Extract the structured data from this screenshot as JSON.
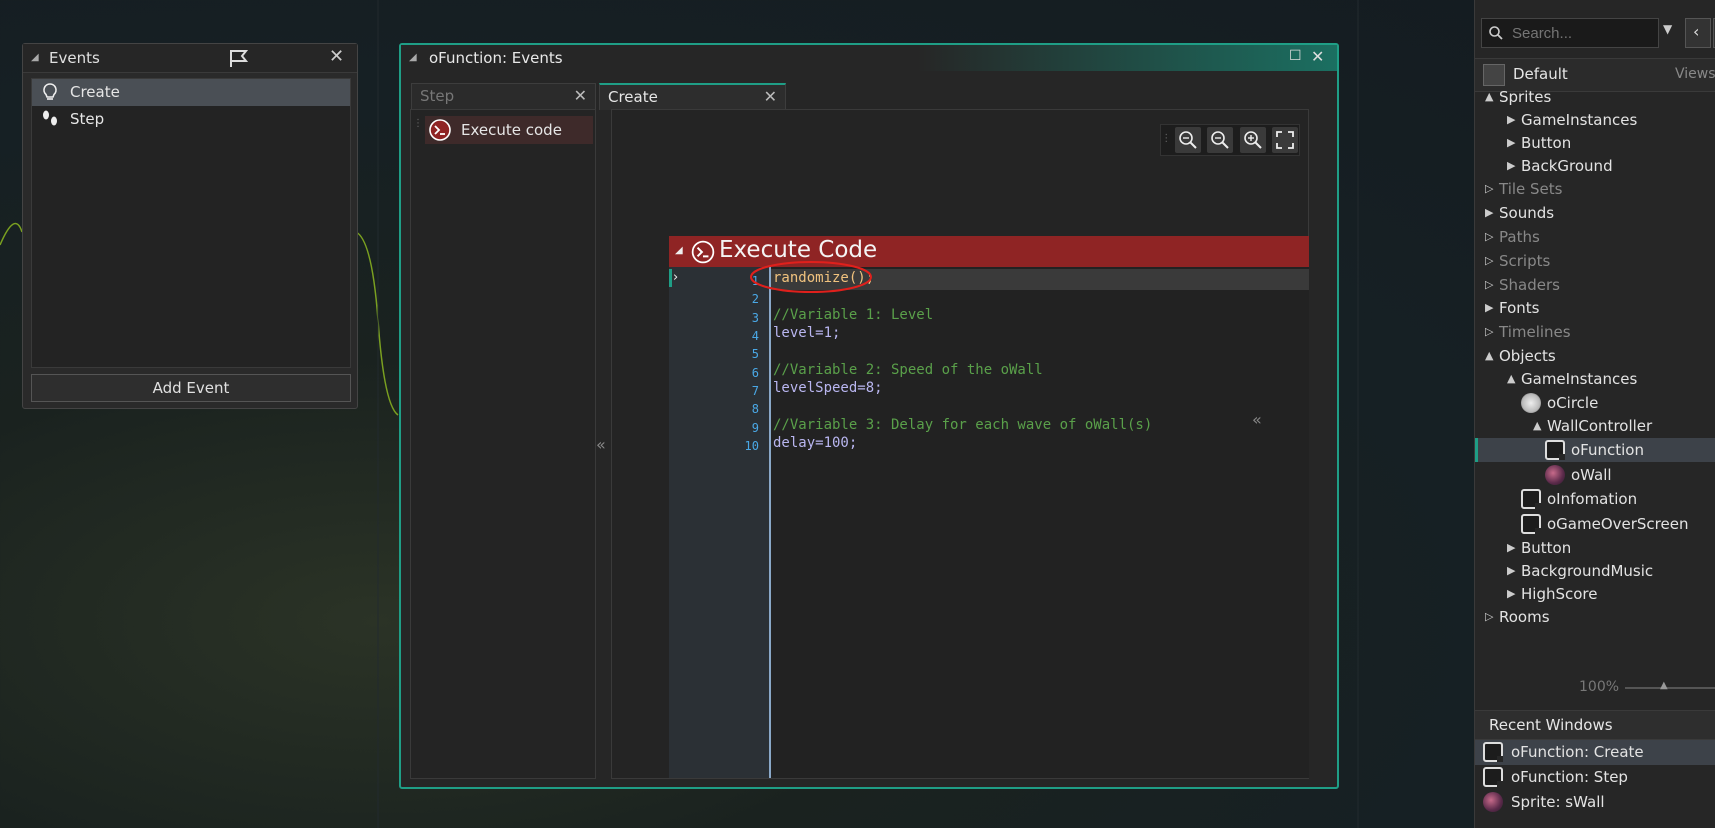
{
  "events_panel": {
    "title": "Events",
    "items": [
      {
        "label": "Create",
        "icon": "lightbulb-icon",
        "selected": true
      },
      {
        "label": "Step",
        "icon": "footsteps-icon",
        "selected": false
      }
    ],
    "add_event_label": "Add Event"
  },
  "object_panel": {
    "title": "oFunction: Events",
    "tabs": [
      {
        "label": "Step",
        "active": false
      },
      {
        "label": "Create",
        "active": true
      }
    ],
    "action_item_label": "Execute code",
    "collapse_glyph": "«",
    "exec_block": {
      "title": "Execute Code",
      "code_lines": [
        {
          "n": "1",
          "text": "randomize();"
        },
        {
          "n": "2",
          "text": ""
        },
        {
          "n": "3",
          "text": "//Variable 1: Level"
        },
        {
          "n": "4",
          "text": "level=1;"
        },
        {
          "n": "5",
          "text": ""
        },
        {
          "n": "6",
          "text": "//Variable 2: Speed of the oWall"
        },
        {
          "n": "7",
          "text": "levelSpeed=8;"
        },
        {
          "n": "8",
          "text": ""
        },
        {
          "n": "9",
          "text": "//Variable 3: Delay for each wave of oWall(s)"
        },
        {
          "n": "10",
          "text": "delay=100;"
        }
      ]
    }
  },
  "resource_panel": {
    "search_placeholder": "Search...",
    "group_label": "Default",
    "views_label": "Views",
    "tree": [
      {
        "label": "Sprites",
        "expanded": true
      },
      {
        "label": "GameInstances"
      },
      {
        "label": "Button"
      },
      {
        "label": "BackGround"
      },
      {
        "label": "Tile Sets"
      },
      {
        "label": "Sounds"
      },
      {
        "label": "Paths"
      },
      {
        "label": "Scripts"
      },
      {
        "label": "Shaders"
      },
      {
        "label": "Fonts"
      },
      {
        "label": "Timelines"
      },
      {
        "label": "Objects",
        "expanded": true
      },
      {
        "label": "GameInstances",
        "expanded": true
      },
      {
        "label": "oCircle"
      },
      {
        "label": "WallController",
        "expanded": true
      },
      {
        "label": "oFunction",
        "selected": true
      },
      {
        "label": "oWall"
      },
      {
        "label": "oInfomation"
      },
      {
        "label": "oGameOverScreen"
      },
      {
        "label": "Button"
      },
      {
        "label": "BackgroundMusic"
      },
      {
        "label": "HighScore"
      },
      {
        "label": "Rooms"
      }
    ],
    "zoom_label": "100%",
    "recent_title": "Recent Windows",
    "recent": [
      {
        "label": "oFunction: Create",
        "selected": true
      },
      {
        "label": "oFunction: Step"
      },
      {
        "label": "Sprite: sWall"
      }
    ]
  },
  "colors": {
    "accent": "#1f9e86",
    "exec_header": "#8f2424",
    "annotation": "#e0201c"
  }
}
